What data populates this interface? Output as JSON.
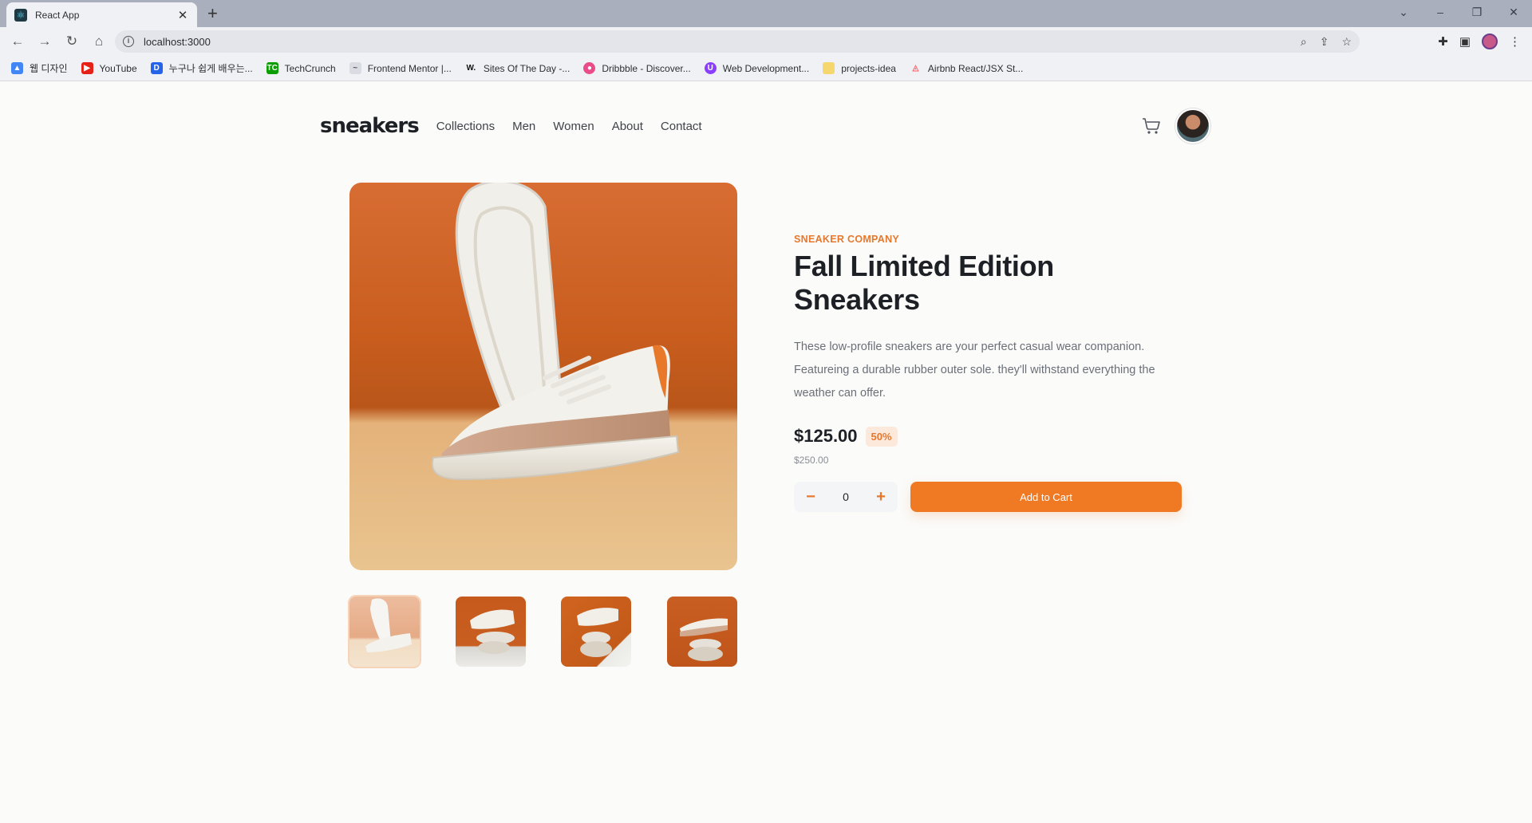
{
  "browser": {
    "tab_title": "React App",
    "url": "localhost:3000",
    "bookmarks": [
      {
        "label": "웹 디자인",
        "icon": "google-drive-icon",
        "color": "#4285f4"
      },
      {
        "label": "YouTube",
        "icon": "youtube-icon",
        "color": "#e62117"
      },
      {
        "label": "누구나 쉽게 배우는...",
        "icon": "dreamcoding-icon",
        "color": "#2563eb"
      },
      {
        "label": "TechCrunch",
        "icon": "techcrunch-icon",
        "color": "#0a9e01"
      },
      {
        "label": "Frontend Mentor |...",
        "icon": "frontend-mentor-icon",
        "color": "#d9dce3"
      },
      {
        "label": "Sites Of The Day -...",
        "icon": "awwwards-icon",
        "color": "#111111"
      },
      {
        "label": "Dribbble - Discover...",
        "icon": "dribbble-icon",
        "color": "#ea4c89"
      },
      {
        "label": "Web Development...",
        "icon": "udemy-icon",
        "color": "#8a3ffc"
      },
      {
        "label": "projects-idea",
        "icon": "folder-icon",
        "color": "#f5d76e"
      },
      {
        "label": "Airbnb React/JSX St...",
        "icon": "airbnb-icon",
        "color": "#ff5a5f"
      }
    ]
  },
  "site": {
    "logo": "sneakers",
    "nav": [
      "Collections",
      "Men",
      "Women",
      "About",
      "Contact"
    ]
  },
  "product": {
    "company": "Sneaker Company",
    "title": "Fall Limited Edition Sneakers",
    "description": "These low-profile sneakers are your perfect casual wear companion. Featureing a durable rubber outer sole. they'll withstand everything the weather can offer.",
    "price": "$125.00",
    "discount": "50%",
    "old_price": "$250.00",
    "quantity": "0",
    "minus": "−",
    "plus": "+",
    "add_to_cart": "Add to Cart"
  },
  "colors": {
    "accent": "#f07a24",
    "accent_light": "#fde9dc",
    "text_dark": "#1d2025"
  }
}
